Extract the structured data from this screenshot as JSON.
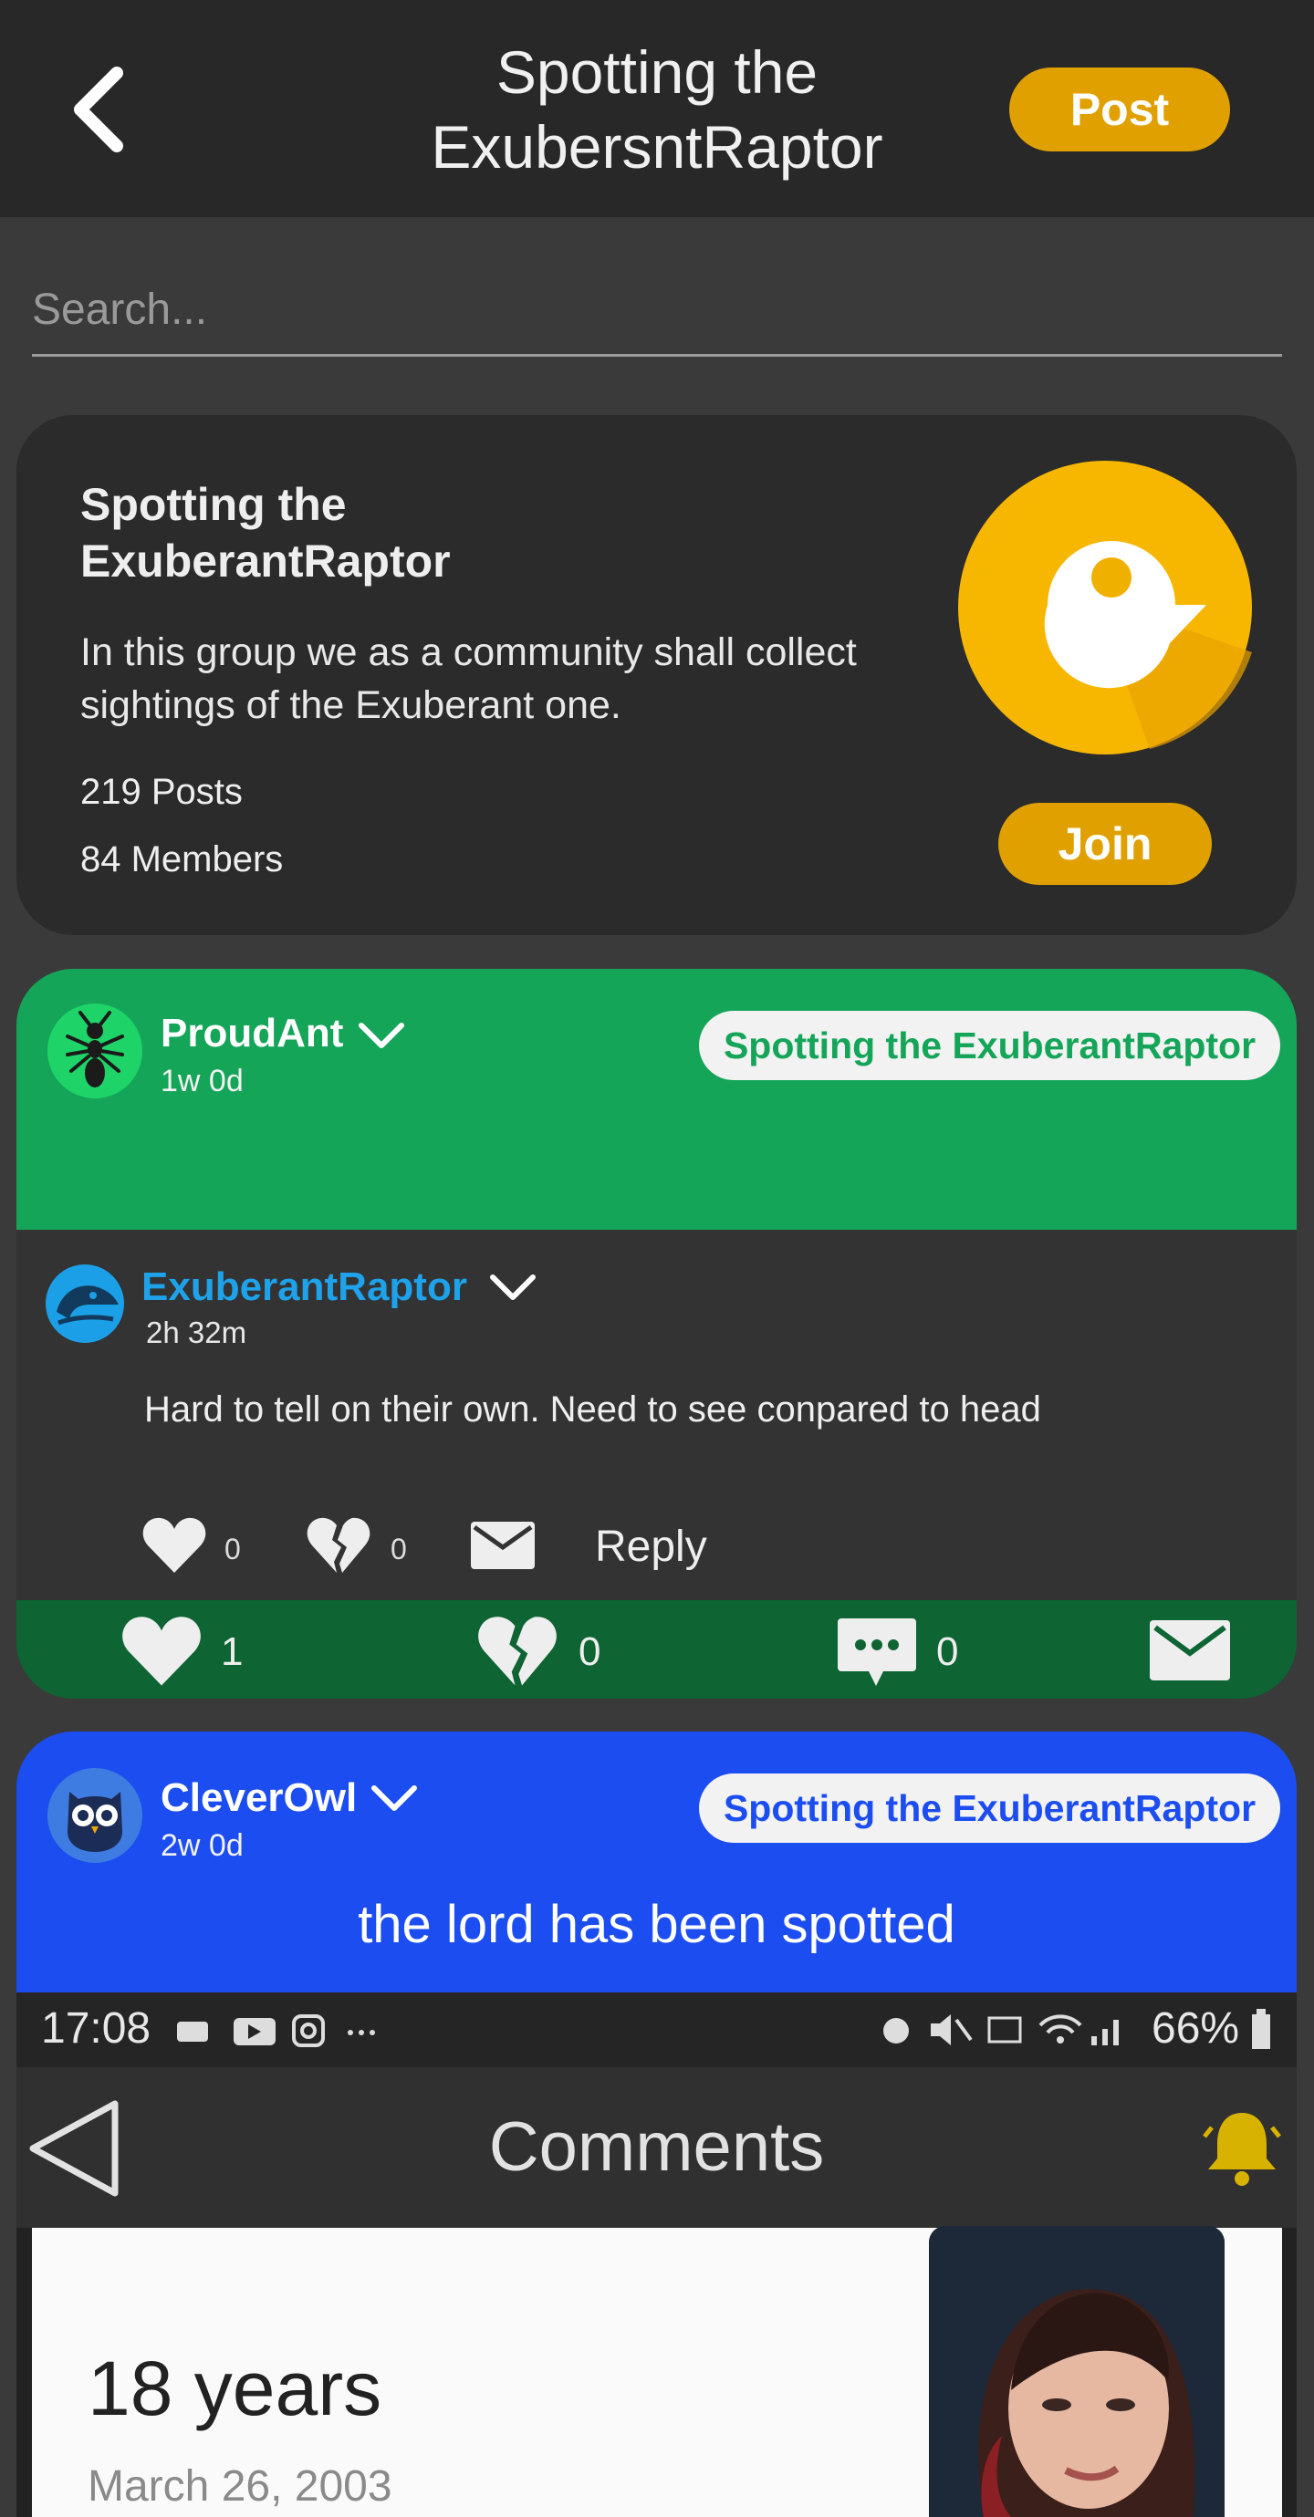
{
  "header": {
    "title": "Spotting the ExubersntRaptor",
    "post_label": "Post"
  },
  "search": {
    "placeholder": "Search..."
  },
  "group": {
    "name": "Spotting the ExuberantRaptor",
    "description": "In this group we as a community shall collect sightings of the Exuberant one.",
    "posts": "219 Posts",
    "members": "84 Members",
    "join_label": "Join"
  },
  "posts": [
    {
      "username": "ProudAnt",
      "time": "1w 0d",
      "group_tag": "Spotting the ExuberantRaptor",
      "comment": {
        "username": "ExuberantRaptor",
        "time": "2h 32m",
        "text": "Hard to tell on their own. Need to see conpared to head",
        "likes": "0",
        "dislikes": "0",
        "reply_label": "Reply"
      },
      "likes": "1",
      "dislikes": "0",
      "comments": "0"
    },
    {
      "username": "CleverOwl",
      "time": "2w 0d",
      "group_tag": "Spotting the ExuberantRaptor",
      "text": "the lord has been spotted",
      "image": {
        "clock": "17:08",
        "battery": "66%",
        "title": "Comments",
        "years": "18 years",
        "date": "March 26, 2003"
      }
    }
  ],
  "colors": {
    "accent": "#e0a100",
    "post_green": "#15a558",
    "post_green_dark": "#0e6433",
    "post_blue": "#1c4df0",
    "raptor_blue": "#1ea2ea"
  }
}
